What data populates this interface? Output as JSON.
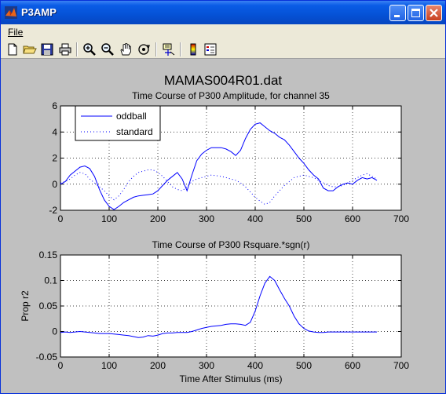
{
  "window": {
    "title": "P3AMP"
  },
  "menu": {
    "file": "File"
  },
  "toolbar": {
    "icons": [
      "new-file-icon",
      "open-folder-icon",
      "save-icon",
      "print-icon",
      "zoom-in-icon",
      "zoom-out-icon",
      "pan-hand-icon",
      "rotate-3d-icon",
      "data-cursor-icon",
      "colorbar-icon",
      "legend-icon"
    ]
  },
  "figure": {
    "title": "MAMAS004R01.dat"
  },
  "chart_data": [
    {
      "type": "line",
      "title": "Time Course of P300 Amplitude, for channel 35",
      "xlabel": "",
      "ylabel": "",
      "xlim": [
        0,
        700
      ],
      "ylim": [
        -2,
        6
      ],
      "xticks": [
        0,
        100,
        200,
        300,
        400,
        500,
        600,
        700
      ],
      "yticks": [
        -2,
        0,
        2,
        4,
        6
      ],
      "grid": true,
      "legend_position": "top-left",
      "series": [
        {
          "name": "oddball",
          "style": "solid",
          "color": "#0000ff",
          "x": [
            0,
            10,
            20,
            30,
            40,
            50,
            60,
            70,
            80,
            90,
            100,
            110,
            120,
            130,
            140,
            150,
            160,
            170,
            180,
            190,
            200,
            210,
            220,
            230,
            240,
            250,
            260,
            270,
            280,
            290,
            300,
            310,
            320,
            330,
            340,
            350,
            360,
            370,
            380,
            390,
            400,
            410,
            420,
            430,
            440,
            450,
            460,
            470,
            480,
            490,
            500,
            510,
            520,
            530,
            540,
            550,
            560,
            570,
            580,
            590,
            600,
            610,
            620,
            630,
            640,
            650
          ],
          "y": [
            0.0,
            0.2,
            0.7,
            1.0,
            1.3,
            1.4,
            1.2,
            0.6,
            -0.4,
            -1.2,
            -1.7,
            -1.95,
            -1.7,
            -1.4,
            -1.2,
            -1.0,
            -0.9,
            -0.85,
            -0.8,
            -0.75,
            -0.5,
            -0.1,
            0.3,
            0.6,
            0.9,
            0.4,
            -0.5,
            0.7,
            1.8,
            2.3,
            2.6,
            2.8,
            2.8,
            2.8,
            2.7,
            2.5,
            2.2,
            2.6,
            3.5,
            4.2,
            4.6,
            4.7,
            4.4,
            4.1,
            3.9,
            3.6,
            3.4,
            3.0,
            2.5,
            2.0,
            1.6,
            1.1,
            0.7,
            0.4,
            -0.3,
            -0.5,
            -0.5,
            -0.2,
            0.0,
            0.1,
            0.0,
            0.3,
            0.5,
            0.4,
            0.5,
            0.3
          ]
        },
        {
          "name": "standard",
          "style": "dotted",
          "color": "#0000ff",
          "x": [
            0,
            10,
            20,
            30,
            40,
            50,
            60,
            70,
            80,
            90,
            100,
            110,
            120,
            130,
            140,
            150,
            160,
            170,
            180,
            190,
            200,
            210,
            220,
            230,
            240,
            250,
            260,
            270,
            280,
            290,
            300,
            310,
            320,
            330,
            340,
            350,
            360,
            370,
            380,
            390,
            400,
            410,
            420,
            430,
            440,
            450,
            460,
            470,
            480,
            490,
            500,
            510,
            520,
            530,
            540,
            550,
            560,
            570,
            580,
            590,
            600,
            610,
            620,
            630,
            640,
            650
          ],
          "y": [
            0.1,
            0.2,
            0.4,
            0.7,
            0.9,
            0.8,
            0.4,
            0.1,
            -0.2,
            -0.5,
            -0.9,
            -1.2,
            -0.9,
            -0.4,
            0.2,
            0.6,
            0.9,
            1.0,
            1.1,
            1.1,
            0.9,
            0.6,
            0.2,
            -0.2,
            -0.4,
            -0.5,
            -0.2,
            0.2,
            0.4,
            0.5,
            0.6,
            0.7,
            0.65,
            0.6,
            0.5,
            0.4,
            0.3,
            0.1,
            -0.2,
            -0.6,
            -1.0,
            -1.3,
            -1.55,
            -1.4,
            -0.9,
            -0.5,
            -0.1,
            0.2,
            0.5,
            0.6,
            0.7,
            0.6,
            0.5,
            0.3,
            0.1,
            -0.1,
            -0.2,
            -0.2,
            -0.1,
            0.1,
            0.3,
            0.5,
            0.7,
            0.8,
            0.6,
            0.4
          ]
        }
      ]
    },
    {
      "type": "line",
      "title": "Time Course of P300 Rsquare.*sgn(r)",
      "xlabel": "Time After Stimulus (ms)",
      "ylabel": "Prop r2",
      "xlim": [
        0,
        700
      ],
      "ylim": [
        -0.05,
        0.15
      ],
      "xticks": [
        0,
        100,
        200,
        300,
        400,
        500,
        600,
        700
      ],
      "yticks": [
        -0.05,
        0,
        0.05,
        0.1,
        0.15
      ],
      "ytick_labels": [
        "-0.05",
        "0",
        "0.05",
        "0.1",
        "0.15"
      ],
      "grid": true,
      "series": [
        {
          "style": "solid",
          "color": "#0000ff",
          "x": [
            0,
            10,
            20,
            30,
            40,
            50,
            60,
            70,
            80,
            90,
            100,
            110,
            120,
            130,
            140,
            150,
            160,
            170,
            180,
            190,
            200,
            210,
            220,
            230,
            240,
            250,
            260,
            270,
            280,
            290,
            300,
            310,
            320,
            330,
            340,
            350,
            360,
            370,
            380,
            390,
            400,
            410,
            420,
            430,
            440,
            450,
            460,
            470,
            480,
            490,
            500,
            510,
            520,
            530,
            540,
            550,
            560,
            570,
            580,
            590,
            600,
            610,
            620,
            630,
            640,
            650
          ],
          "y": [
            -0.002,
            -0.001,
            -0.002,
            -0.001,
            0.0,
            -0.001,
            -0.002,
            -0.003,
            -0.004,
            -0.004,
            -0.004,
            -0.005,
            -0.006,
            -0.007,
            -0.008,
            -0.01,
            -0.012,
            -0.011,
            -0.008,
            -0.009,
            -0.007,
            -0.004,
            -0.003,
            -0.003,
            -0.002,
            -0.002,
            -0.002,
            0.0,
            0.003,
            0.006,
            0.008,
            0.01,
            0.011,
            0.012,
            0.014,
            0.015,
            0.015,
            0.014,
            0.012,
            0.018,
            0.04,
            0.07,
            0.095,
            0.108,
            0.1,
            0.082,
            0.065,
            0.05,
            0.03,
            0.015,
            0.006,
            0.001,
            -0.001,
            -0.002,
            -0.002,
            -0.001,
            -0.001,
            -0.001,
            -0.001,
            -0.001,
            -0.001,
            -0.001,
            -0.001,
            -0.001,
            -0.001,
            -0.001
          ]
        }
      ]
    }
  ]
}
